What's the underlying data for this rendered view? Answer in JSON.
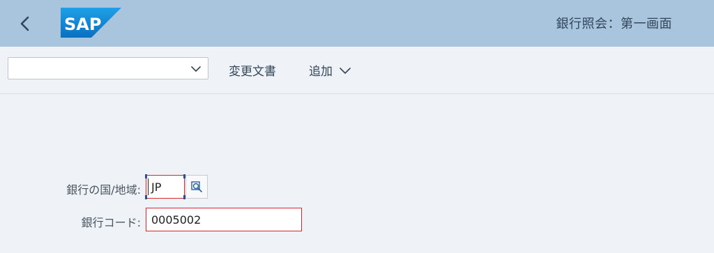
{
  "shell": {
    "back_icon": "chevron-left-icon",
    "logo_text": "SAP",
    "title": "銀行照会：第一画面"
  },
  "toolbar": {
    "variant_value": "",
    "changes_label": "変更文書",
    "add_label": "追加",
    "add_icon": "chevron-down-icon"
  },
  "form": {
    "country_label": "銀行の国/地域:",
    "country_value": "JP",
    "valuehelp_icon": "value-help-icon",
    "bankcode_label": "銀行コード:",
    "bankcode_value": "0005002"
  },
  "colors": {
    "shell_bg": "#a9c4dd",
    "page_bg": "#eff3f7",
    "error_border": "#d8262e",
    "logo_blue": "#0a7bd4"
  }
}
